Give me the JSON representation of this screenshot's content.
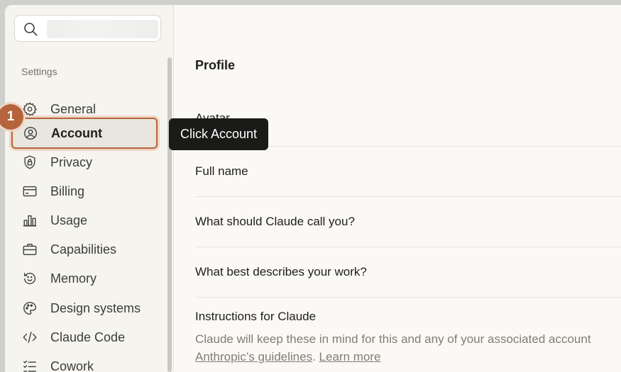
{
  "sidebar": {
    "search": {
      "placeholder": ""
    },
    "section_label": "Settings",
    "items": [
      {
        "label": "General",
        "icon": "gear-icon"
      },
      {
        "label": "Account",
        "icon": "user-circle-icon"
      },
      {
        "label": "Privacy",
        "icon": "shield-lock-icon"
      },
      {
        "label": "Billing",
        "icon": "credit-card-icon"
      },
      {
        "label": "Usage",
        "icon": "bar-chart-icon"
      },
      {
        "label": "Capabilities",
        "icon": "briefcase-icon"
      },
      {
        "label": "Memory",
        "icon": "history-icon"
      },
      {
        "label": "Design systems",
        "icon": "palette-icon"
      },
      {
        "label": "Claude Code",
        "icon": "code-icon"
      },
      {
        "label": "Cowork",
        "icon": "checklist-icon"
      }
    ],
    "active_item": "Account"
  },
  "annotation": {
    "step_number": "1",
    "tooltip": "Click Account"
  },
  "main": {
    "section_title": "Profile",
    "fields": {
      "avatar": "Avatar",
      "full_name": "Full name",
      "call_you": "What should Claude call you?",
      "describes_work": "What best describes your work?",
      "instructions": "Instructions for Claude"
    },
    "instructions_help": {
      "text": "Claude will keep these in mind for this and any of your associated account",
      "guidelines_link": "Anthropic’s guidelines",
      "period": ".",
      "learn_more": "Learn more"
    }
  },
  "colors": {
    "accent": "#b5643b",
    "tooltip_bg": "#1a1a18",
    "sidebar_bg": "#f5f4ef",
    "content_bg": "#faf9f5"
  }
}
